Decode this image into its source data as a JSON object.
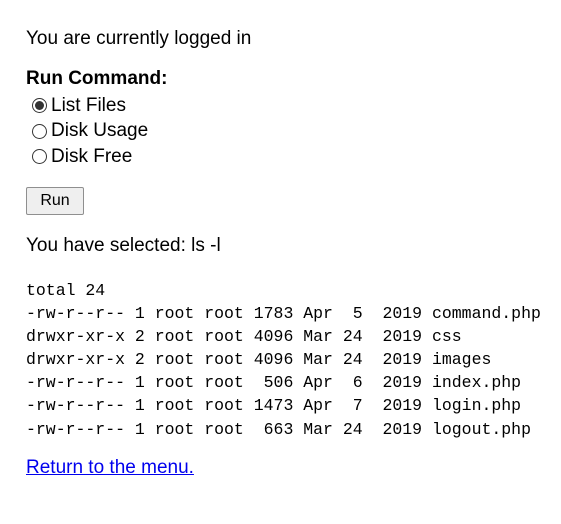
{
  "status_text": "You are currently logged in",
  "form": {
    "title": "Run Command:",
    "options": [
      {
        "label": "List Files",
        "checked": true
      },
      {
        "label": "Disk Usage",
        "checked": false
      },
      {
        "label": "Disk Free",
        "checked": false
      }
    ],
    "run_label": "Run"
  },
  "selected_text": "You have selected: ls -l",
  "output_lines": [
    "total 24",
    "-rw-r--r-- 1 root root 1783 Apr  5  2019 command.php",
    "drwxr-xr-x 2 root root 4096 Mar 24  2019 css",
    "drwxr-xr-x 2 root root 4096 Mar 24  2019 images",
    "-rw-r--r-- 1 root root  506 Apr  6  2019 index.php",
    "-rw-r--r-- 1 root root 1473 Apr  7  2019 login.php",
    "-rw-r--r-- 1 root root  663 Mar 24  2019 logout.php"
  ],
  "return_link": "Return to the menu.",
  "colors": {
    "link": "#0000ee",
    "text": "#000000",
    "button_bg": "#efefef"
  }
}
